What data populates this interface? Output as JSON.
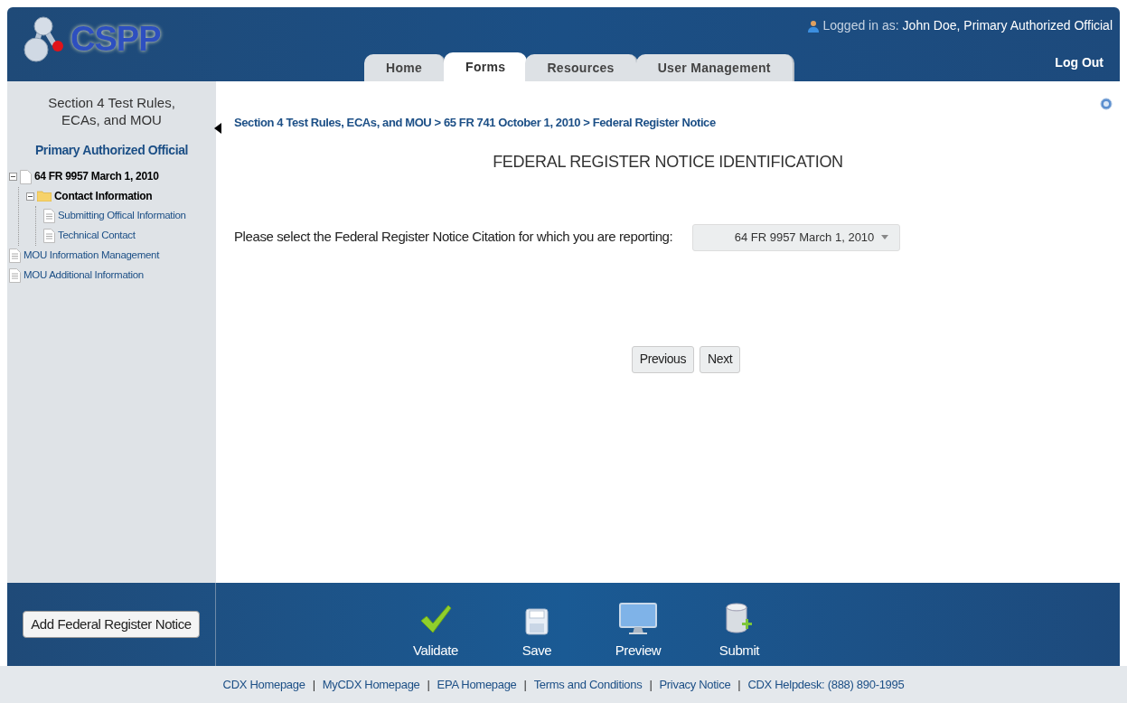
{
  "header": {
    "logo": "CSPP",
    "user_label": "Logged in as:",
    "user_name": "John Doe, Primary Authorized Official",
    "logout": "Log Out",
    "tabs": [
      {
        "label": "Home",
        "selected": false
      },
      {
        "label": "Forms",
        "selected": true
      },
      {
        "label": "Resources",
        "selected": false
      },
      {
        "label": "User Management",
        "selected": false
      }
    ]
  },
  "sidebar": {
    "title": "Section 4 Test Rules, ECAs, and MOU",
    "role": "Primary Authorized Official",
    "tree": [
      {
        "label": "64 FR 9957 March 1, 2010",
        "kind": "document",
        "expanded": true,
        "children": [
          {
            "label": "Contact Information",
            "kind": "folder",
            "expanded": true,
            "children": [
              {
                "label": "Submitting Offical Information",
                "kind": "page"
              },
              {
                "label": "Technical Contact",
                "kind": "page"
              }
            ]
          }
        ]
      },
      {
        "label": "MOU Information Management",
        "kind": "page"
      },
      {
        "label": "MOU Additional Information",
        "kind": "page"
      }
    ]
  },
  "breadcrumb": "Section 4 Test Rules, ECAs, and MOU > 65 FR 741 October 1, 2010 > Federal Register Notice",
  "heading": "FEDERAL REGISTER NOTICE IDENTIFICATION",
  "citation": {
    "label": "Please select the Federal Register Notice Citation for which you are reporting:",
    "value": "64 FR 9957 March 1, 2010"
  },
  "nav_buttons": [
    "Previous",
    "Next"
  ],
  "add_button": "Add Federal Register Notice",
  "actions": [
    {
      "label": "Validate",
      "kind": "validate"
    },
    {
      "label": "Save",
      "kind": "save"
    },
    {
      "label": "Preview",
      "kind": "preview"
    },
    {
      "label": "Submit",
      "kind": "submit"
    }
  ],
  "footer": {
    "separator": "|",
    "links": [
      "CDX Homepage",
      "MyCDX Homepage",
      "EPA Homepage",
      "Terms and Conditions",
      "Privacy Notice",
      "CDX Helpdesk: (888) 890-1995"
    ]
  }
}
